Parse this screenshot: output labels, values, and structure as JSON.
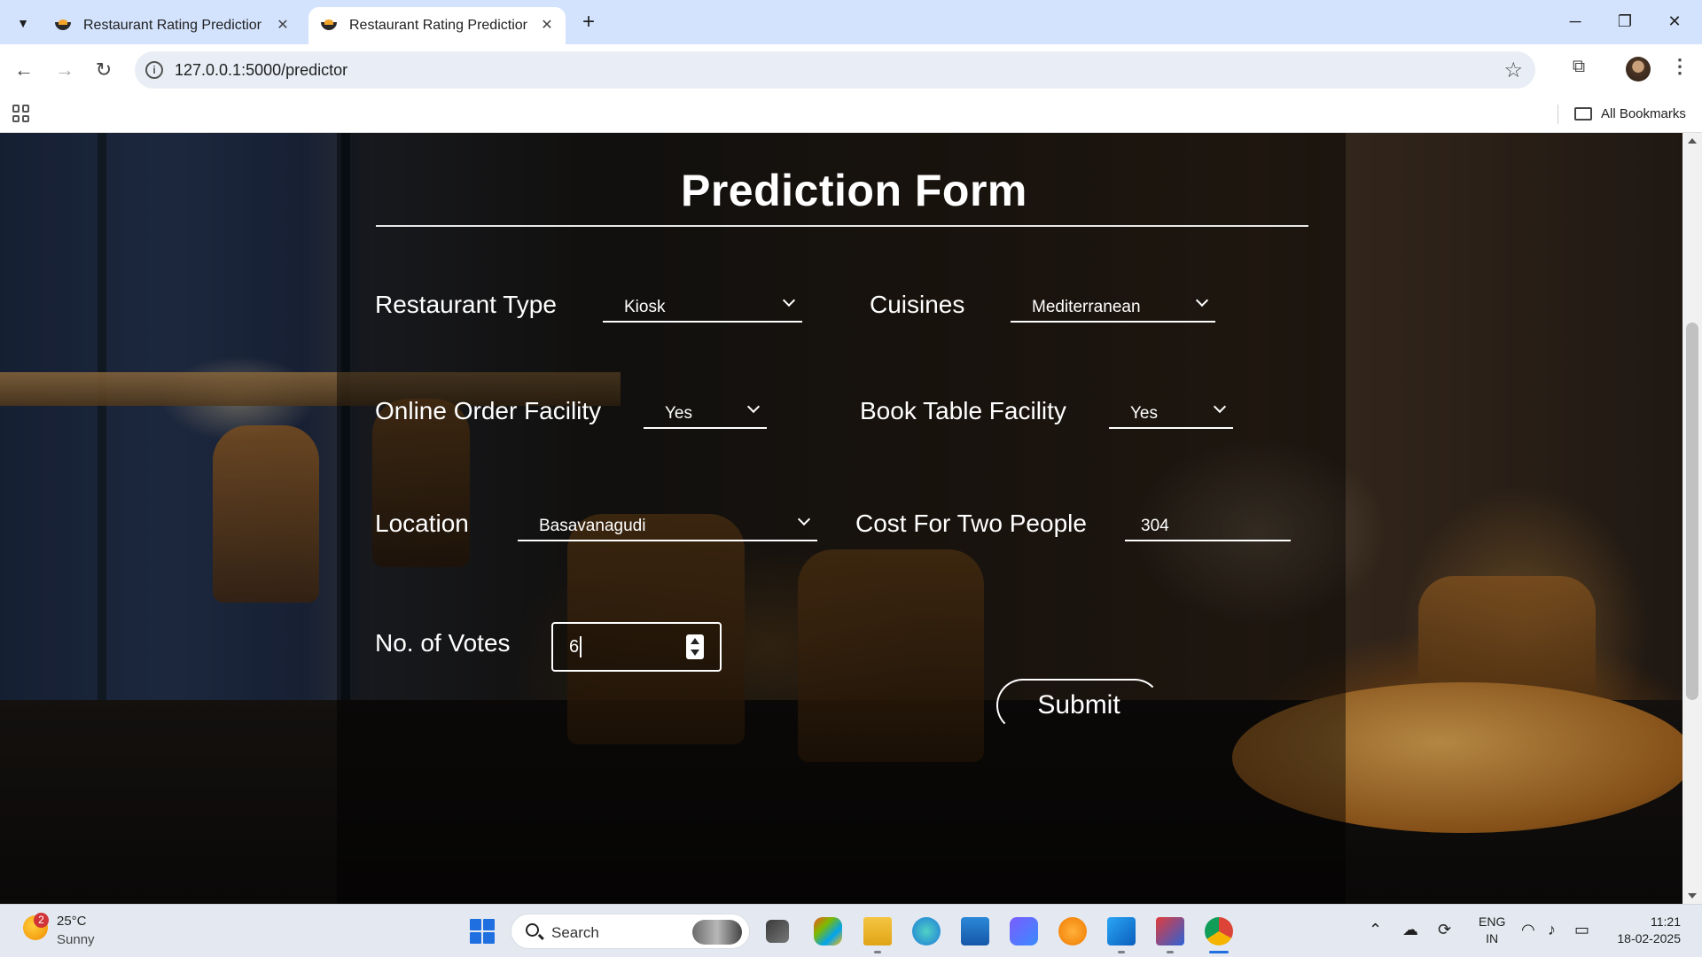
{
  "browser": {
    "tabs": [
      {
        "title": "Restaurant Rating Predictior",
        "active": false
      },
      {
        "title": "Restaurant Rating Predictior",
        "active": true
      }
    ],
    "url": "127.0.0.1:5000/predictor",
    "bookmarks_label": "All Bookmarks",
    "controls": {
      "minimize": "─",
      "restore": "❐",
      "close": "✕",
      "new_tab": "+",
      "tab_close": "✕"
    }
  },
  "form": {
    "title": "Prediction Form",
    "fields": {
      "restaurant_type": {
        "label": "Restaurant Type",
        "value": "Kiosk"
      },
      "cuisines": {
        "label": "Cuisines",
        "value": "Mediterranean"
      },
      "online_order": {
        "label": "Online Order Facility",
        "value": "Yes"
      },
      "book_table": {
        "label": "Book Table Facility",
        "value": "Yes"
      },
      "location": {
        "label": "Location",
        "value": "Basavanagudi"
      },
      "cost_for_two": {
        "label": "Cost For Two People",
        "value": "304"
      },
      "votes": {
        "label": "No. of Votes",
        "value": "6"
      }
    },
    "submit_label": "Submit"
  },
  "taskbar": {
    "weather": {
      "temp": "25°C",
      "condition": "Sunny",
      "badge": "2"
    },
    "search_text": "Search",
    "language": {
      "line1": "ENG",
      "line2": "IN"
    },
    "time": "11:21",
    "date": "18-02-2025"
  },
  "colors": {
    "tabstrip": "#d3e3fd",
    "accent": "#1f6fe0",
    "form_text": "#ffffff"
  }
}
